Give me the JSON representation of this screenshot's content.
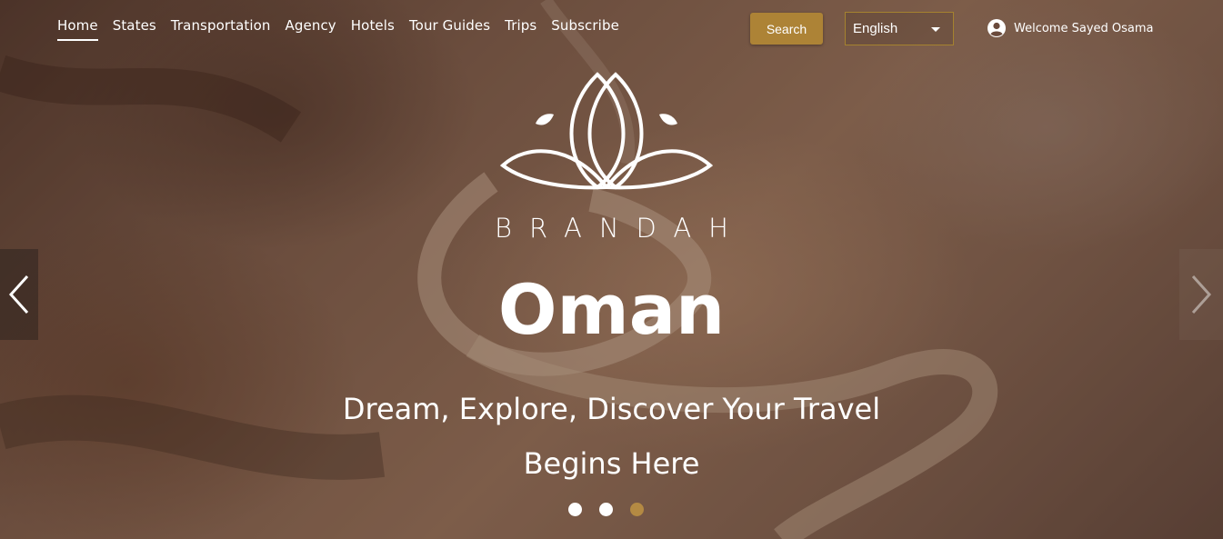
{
  "nav": {
    "items": [
      {
        "label": "Home",
        "active": true
      },
      {
        "label": "States"
      },
      {
        "label": "Transportation"
      },
      {
        "label": "Agency"
      },
      {
        "label": "Hotels"
      },
      {
        "label": "Tour Guides"
      },
      {
        "label": "Trips"
      },
      {
        "label": "Subscribe"
      }
    ]
  },
  "header": {
    "search_label": "Search",
    "language": {
      "selected": "English"
    },
    "user": {
      "welcome": "Welcome Sayed Osama",
      "icon": "user-circle-icon"
    }
  },
  "hero": {
    "brand": "BRANDAH",
    "country": "Oman",
    "tagline_line1": "Dream, Explore, Discover Your Travel",
    "tagline_line2": "Begins Here",
    "slides": {
      "count": 3,
      "active_index": 2
    }
  },
  "colors": {
    "accent": "#ad8336",
    "active_dot": "#b48a43",
    "text": "#ffffff"
  },
  "icons": {
    "prev": "chevron-left-icon",
    "next": "chevron-right-icon",
    "dropdown": "caret-down-icon",
    "logo": "lotus-logo-icon"
  }
}
